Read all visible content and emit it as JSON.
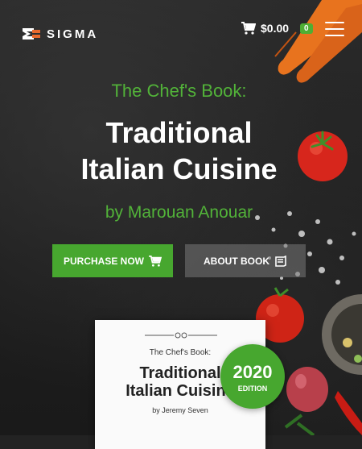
{
  "brand": {
    "name": "SIGMA"
  },
  "cart": {
    "total": "$0.00",
    "count": "0",
    "icon": "cart-icon"
  },
  "menu": {
    "icon": "hamburger-menu-icon"
  },
  "hero": {
    "kicker": "The Chef's Book:",
    "title_line1": "Traditional",
    "title_line2": "Italian Cuisine",
    "author": "by Marouan Anouar"
  },
  "buttons": {
    "purchase_label": "PURCHASE NOW",
    "about_label": "ABOUT BOOK"
  },
  "book": {
    "kicker": "The Chef's Book:",
    "title_line1": "Traditional",
    "title_line2": "Italian Cuisine",
    "author": "by Jeremy Seven"
  },
  "edition": {
    "year": "2020",
    "label": "EDITION"
  },
  "colors": {
    "accent": "#47a72f",
    "background": "#232323"
  }
}
